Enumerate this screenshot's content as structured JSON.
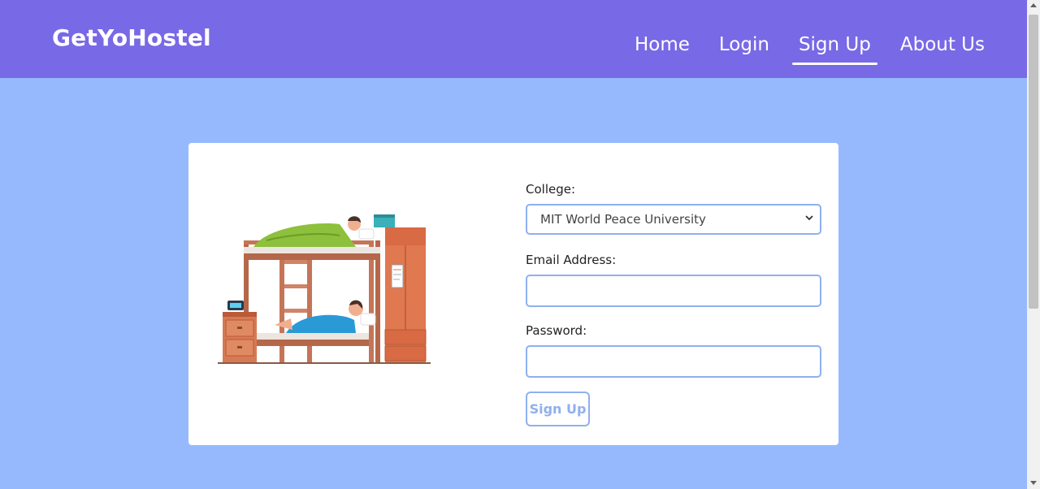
{
  "navbar": {
    "brand": "GetYoHostel",
    "links": [
      {
        "label": "Home",
        "active": false
      },
      {
        "label": "Login",
        "active": false
      },
      {
        "label": "Sign Up",
        "active": true
      },
      {
        "label": "About Us",
        "active": false
      }
    ]
  },
  "form": {
    "college_label": "College:",
    "college_selected": "MIT World Peace University",
    "email_label": "Email Address:",
    "email_value": "",
    "password_label": "Password:",
    "password_value": "",
    "submit_label": "Sign Up"
  },
  "colors": {
    "navbar": "#7869e6",
    "page_background": "#96b9fd",
    "input_border": "#8fb0ee"
  },
  "icons": {
    "select_arrow": "chevron-down-icon",
    "illustration": "bunk-bed-illustration"
  }
}
